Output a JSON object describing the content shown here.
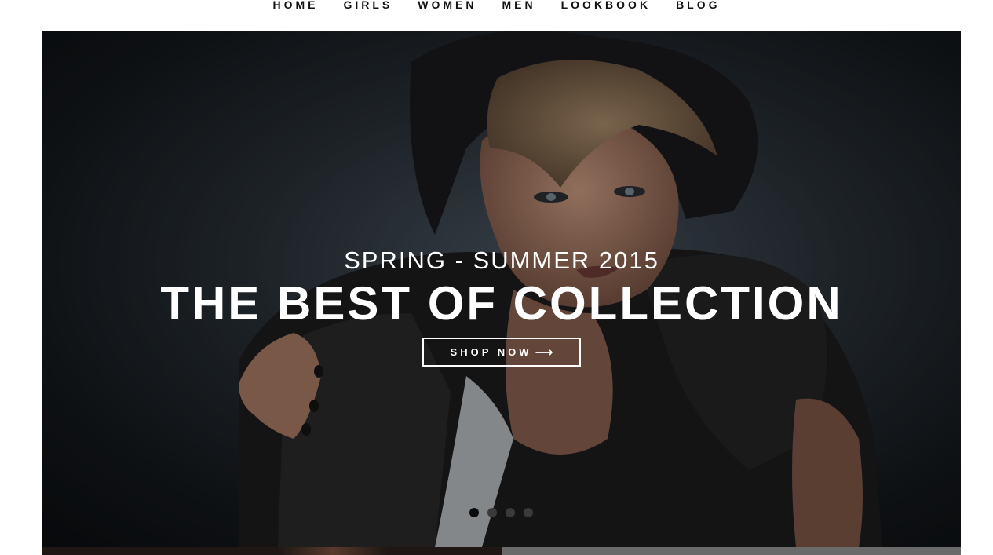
{
  "nav": {
    "items": [
      {
        "label": "HOME"
      },
      {
        "label": "GIRLS"
      },
      {
        "label": "WOMEN"
      },
      {
        "label": "MEN"
      },
      {
        "label": "LOOKBOOK"
      },
      {
        "label": "BLOG"
      }
    ]
  },
  "hero": {
    "subtitle": "SPRING - SUMMER 2015",
    "title": "THE BEST OF COLLECTION",
    "button_label": "SHOP NOW",
    "button_arrow": "⟶",
    "slides_count": 4,
    "active_slide": 1
  },
  "colors": {
    "accent_text": "#ffffff",
    "nav_text": "#111111",
    "hero_bg": "#1b2026"
  },
  "icons": {
    "button_arrow": "arrow-right-icon",
    "slider_dot": "dot-icon"
  }
}
